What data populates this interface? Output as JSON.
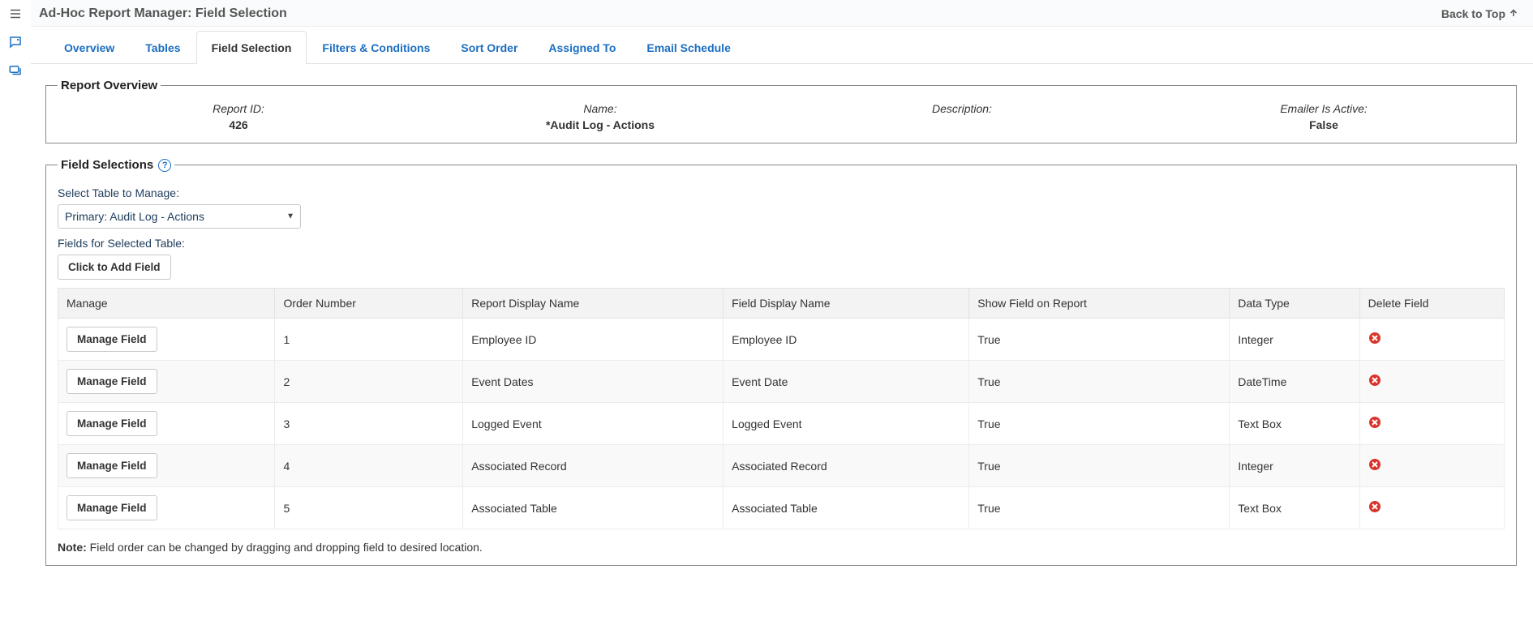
{
  "page": {
    "title": "Ad-Hoc Report Manager: Field Selection",
    "back_to_top": "Back to Top"
  },
  "tabs": [
    {
      "label": "Overview",
      "active": false
    },
    {
      "label": "Tables",
      "active": false
    },
    {
      "label": "Field Selection",
      "active": true
    },
    {
      "label": "Filters & Conditions",
      "active": false
    },
    {
      "label": "Sort Order",
      "active": false
    },
    {
      "label": "Assigned To",
      "active": false
    },
    {
      "label": "Email Schedule",
      "active": false
    }
  ],
  "overview": {
    "legend": "Report Overview",
    "report_id": {
      "label": "Report ID:",
      "value": "426"
    },
    "name": {
      "label": "Name:",
      "value": "*Audit Log - Actions"
    },
    "description": {
      "label": "Description:",
      "value": ""
    },
    "emailer": {
      "label": "Emailer Is Active:",
      "value": "False"
    }
  },
  "selections": {
    "legend": "Field Selections",
    "select_label": "Select Table to Manage:",
    "selected_table": "Primary: Audit Log - Actions",
    "fields_label": "Fields for Selected Table:",
    "add_field_button": "Click to Add Field",
    "manage_button": "Manage Field",
    "columns": {
      "manage": "Manage",
      "order": "Order Number",
      "report_name": "Report Display Name",
      "field_name": "Field Display Name",
      "show": "Show Field on Report",
      "type": "Data Type",
      "del": "Delete Field"
    },
    "rows": [
      {
        "order": "1",
        "report_name": "Employee ID",
        "field_name": "Employee ID",
        "show": "True",
        "type": "Integer"
      },
      {
        "order": "2",
        "report_name": "Event Dates",
        "field_name": "Event Date",
        "show": "True",
        "type": "DateTime"
      },
      {
        "order": "3",
        "report_name": "Logged Event",
        "field_name": "Logged Event",
        "show": "True",
        "type": "Text Box"
      },
      {
        "order": "4",
        "report_name": "Associated Record",
        "field_name": "Associated Record",
        "show": "True",
        "type": "Integer"
      },
      {
        "order": "5",
        "report_name": "Associated Table",
        "field_name": "Associated Table",
        "show": "True",
        "type": "Text Box"
      }
    ],
    "note_prefix": "Note:",
    "note_text": " Field order can be changed by dragging and dropping field to desired location."
  },
  "icons": {
    "menu": "menu-icon",
    "chat": "chat-icon",
    "link": "link-icon",
    "arrow_up": "arrow-up-icon",
    "help": "?"
  }
}
